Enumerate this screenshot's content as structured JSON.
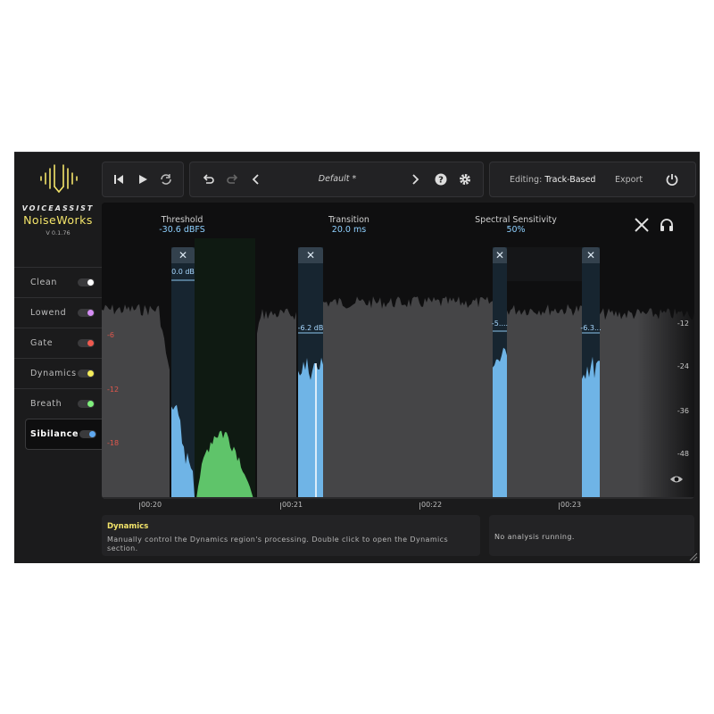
{
  "brand": {
    "company": "VOICEASSIST",
    "product": "NoiseWorks",
    "version": "V 0.1.76"
  },
  "modules": [
    {
      "label": "Clean",
      "dot": "#ffffff",
      "active": false
    },
    {
      "label": "Lowend",
      "dot": "#d58df5",
      "active": false
    },
    {
      "label": "Gate",
      "dot": "#ef5a4f",
      "active": false
    },
    {
      "label": "Dynamics",
      "dot": "#f4ec5a",
      "active": false
    },
    {
      "label": "Breath",
      "dot": "#7ff07c",
      "active": false
    },
    {
      "label": "Sibilance",
      "dot": "#5fa8ef",
      "active": true
    }
  ],
  "toolbar": {
    "preset": "Default *",
    "editing_label": "Editing:",
    "editing_value": "Track-Based",
    "export": "Export"
  },
  "params": [
    {
      "label": "Threshold",
      "value": "-30.6 dBFS"
    },
    {
      "label": "Transition",
      "value": "20.0 ms"
    },
    {
      "label": "Spectral Sensitivity",
      "value": "50%"
    }
  ],
  "db_left": [
    "-6",
    "-12",
    "-18"
  ],
  "db_right": [
    "-12",
    "-24",
    "-36",
    "-48"
  ],
  "bands": [
    {
      "value": "0.0 dB"
    },
    {
      "value": "-6.2 dB"
    },
    {
      "value": "-5...."
    },
    {
      "value": "-6.3..."
    }
  ],
  "timeline": [
    "00:20",
    "00:21",
    "00:22",
    "00:23"
  ],
  "info": {
    "title": "Dynamics",
    "description": "Manually control the Dynamics region's processing. Double click to open the Dynamics section."
  },
  "analysis": "No analysis running.",
  "colors": {
    "accent": "#f3e46a",
    "band": "#6fb4e6",
    "dynamics": "#5fc46a"
  }
}
